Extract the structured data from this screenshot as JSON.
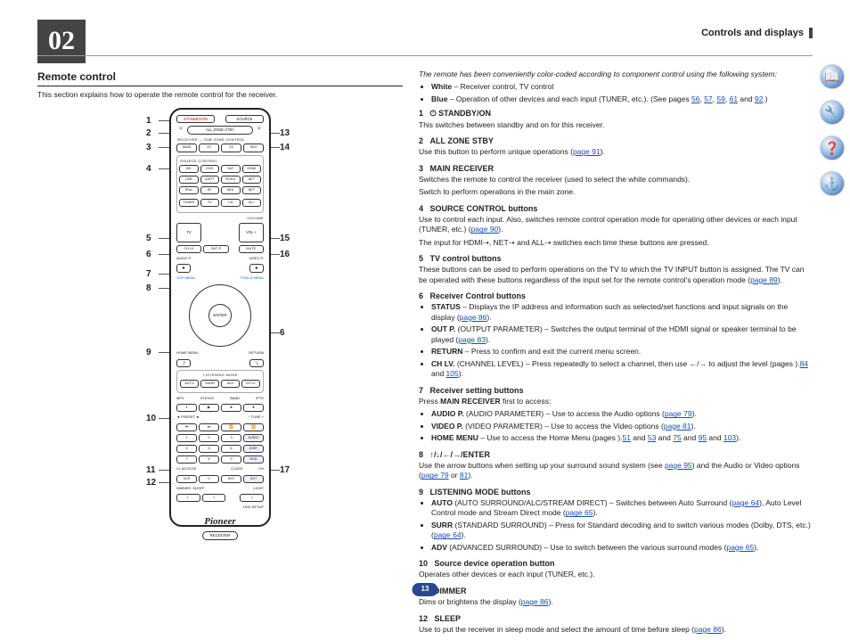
{
  "pageNumberBadge": "13",
  "chapterNum": "02",
  "sectionHeader": "Controls and displays",
  "left": {
    "title": "Remote control",
    "intro": "This section explains how to operate the remote control for the receiver.",
    "calloutsLeft": [
      "1",
      "2",
      "3",
      "4",
      "5",
      "6",
      "7",
      "8",
      "9",
      "10",
      "11",
      "12"
    ],
    "calloutsRight": [
      "13",
      "14",
      "15",
      "16",
      "6",
      "17"
    ]
  },
  "remote": {
    "standby": "STANDBY/ON",
    "source": "SOURCE",
    "allzone": "ALL ZONE STBY",
    "receiver": "RECEIVER",
    "subzone": "SUB ZONE CONTROL",
    "main": "MAIN",
    "z2": "Z2",
    "z3": "Z3",
    "hdz": "HDZ",
    "sourcectrl": "SOURCE CONTROL",
    "bd": "BD",
    "dvd": "DVD",
    "sat": "SAT",
    "hdmi": "HDMI",
    "usb": "USB",
    "adpt": "ADPT",
    "roku": "ROKU",
    "net": "NET",
    "ipod": "iPod",
    "bt": "BT",
    "mhl": "MHL",
    "net2": "NET",
    "tuner": "TUNER",
    "tv": "TV",
    "cd": "CD",
    "all": "ALL",
    "volume": "VOLUME",
    "tvinput": "TV INPUT",
    "volplus": "VOL +",
    "volminus": "−",
    "chlv": "CH LV.",
    "outp": "OUT P.",
    "mute": "MUTE",
    "audiop": "AUDIO P.",
    "videop": "VIDEO P.",
    "topmenu": "TOP MENU",
    "toolsmenu": "TOOLS MENU",
    "enter": "ENTER",
    "homemenu": "HOME MENU",
    "return": "RETURN",
    "listening": "LISTENING MODE",
    "auto": "AUTO",
    "surr": "SURR",
    "adv": "ADV",
    "chlx": "CH LV.",
    "mpx": "MPX",
    "status": "STATUS",
    "band": "BAND",
    "iptv": "iPTV",
    "preset": "PRESET",
    "tune": "TUNE",
    "audio": "AUDIO",
    "disp": "DISP.",
    "hdd": "HDD",
    "ch": "CH",
    "claccess": "CL ACCESS",
    "class": "CLASS",
    "clr": "CLR",
    "zero": "0",
    "ent": "ENT",
    "dimmer": "DIMMER",
    "sleep": "SLEEP",
    "light": "LIGHT",
    "hddsetup": "HDD SETUP",
    "brand": "Pioneer",
    "receiverBadge": "RECEIVER"
  },
  "right": {
    "lead": "The remote has been conveniently color-coded according to component control using the following system:",
    "bullets": [
      {
        "b": "White",
        "t": " – Receiver control, TV control"
      },
      {
        "b": "Blue",
        "t": " – Operation of other devices and each input (TUNER, etc.). (See pages ",
        "links": [
          "56",
          "57",
          "59",
          "61",
          "92"
        ],
        "tail": ".)"
      }
    ],
    "items": [
      {
        "n": "1",
        "title": "⏻ STANDBY/ON",
        "body": "This switches between standby and on for this receiver."
      },
      {
        "n": "2",
        "title": "ALL ZONE STBY",
        "body": "Use this button to perform unique operations (",
        "link": "page 91",
        "tail": ")."
      },
      {
        "n": "3",
        "title": "MAIN RECEIVER",
        "body": "Switches the remote to control the receiver (used to select the white commands).",
        "body2": "Switch to perform operations in the main zone."
      },
      {
        "n": "4",
        "title": "SOURCE CONTROL buttons",
        "body": "Use to control each input. Also, switches remote control operation mode for operating other devices or each input (TUNER, etc.) (",
        "link": "page 90",
        "tail": ").",
        "body2": "The input for HDMI⇢, NET⇢ and ALL⇢ switches each time these buttons are pressed."
      },
      {
        "n": "5",
        "title": "TV control buttons",
        "body": "These buttons can be used to perform operations on the TV to which the TV INPUT button is assigned. The TV can be operated with these buttons regardless of the input set for the remote control's operation mode (",
        "link": "page 89",
        "tail": ")."
      },
      {
        "n": "6",
        "title": "Receiver Control buttons",
        "list": [
          {
            "b": "STATUS",
            "t": " – Displays the IP address and information such as selected/set functions and input signals on the display (",
            "link": "page 86",
            "tail": ")."
          },
          {
            "b": "OUT P.",
            "t": " (OUTPUT PARAMETER) – Switches the output terminal of the HDMI signal or speaker terminal to be played (",
            "link": "page 83",
            "tail": ")."
          },
          {
            "b": "RETURN",
            "t": " – Press to confirm and exit the current menu screen."
          },
          {
            "b": "CH LV.",
            "t": " (CHANNEL LEVEL) – Press repeatedly to select a channel, then use ←/→ to adjust the level (pages ",
            "links": [
              "84",
              "105"
            ],
            "tail": ")."
          }
        ]
      },
      {
        "n": "7",
        "title": "Receiver setting buttons",
        "pre": "Press MAIN RECEIVER first to access:",
        "list": [
          {
            "b": "AUDIO P.",
            "t": " (AUDIO PARAMETER) – Use to access the Audio options (",
            "link": "page 79",
            "tail": ")."
          },
          {
            "b": "VIDEO P.",
            "t": " (VIDEO PARAMETER) – Use to access the Video options (",
            "link": "page 81",
            "tail": ")."
          },
          {
            "b": "HOME MENU",
            "t": " – Use to access the Home Menu (pages ",
            "links": [
              "51",
              "53",
              "75",
              "95",
              "103"
            ],
            "tail": ")."
          }
        ]
      },
      {
        "n": "8",
        "title": "↑/↓/←/→/ENTER",
        "body": "Use the arrow buttons when setting up your surround sound system (see ",
        "link": "page 95",
        "tail": ") and the Audio or Video options (",
        "links": [
          "page 79",
          "81"
        ],
        "tail2": ")."
      },
      {
        "n": "9",
        "title": "LISTENING MODE buttons",
        "list": [
          {
            "b": "AUTO",
            "t": " (AUTO SURROUND/ALC/STREAM DIRECT) – Switches between Auto Surround (",
            "link": "page 64",
            "tail": "), Auto Level Control mode and Stream Direct mode (",
            "link2": "page 65",
            "tail2": ")."
          },
          {
            "b": "SURR",
            "t": " (STANDARD SURROUND) – Press for Standard decoding and to switch various modes (Dolby, DTS, etc.) (",
            "link": "page 64",
            "tail": ")."
          },
          {
            "b": "ADV",
            "t": " (ADVANCED SURROUND) – Use to switch between the various surround modes (",
            "link": "page 65",
            "tail": ")."
          }
        ]
      },
      {
        "n": "10",
        "title": "Source device operation button",
        "body": "Operates other devices or each input (TUNER, etc.)."
      },
      {
        "n": "11",
        "title": "DIMMER",
        "body": "Dims or brightens the display (",
        "link": "page 86",
        "tail": ")."
      },
      {
        "n": "12",
        "title": "SLEEP",
        "body": "Use to put the receiver in sleep mode and select the amount of time before sleep (",
        "link": "page 86",
        "tail": ")."
      }
    ]
  }
}
